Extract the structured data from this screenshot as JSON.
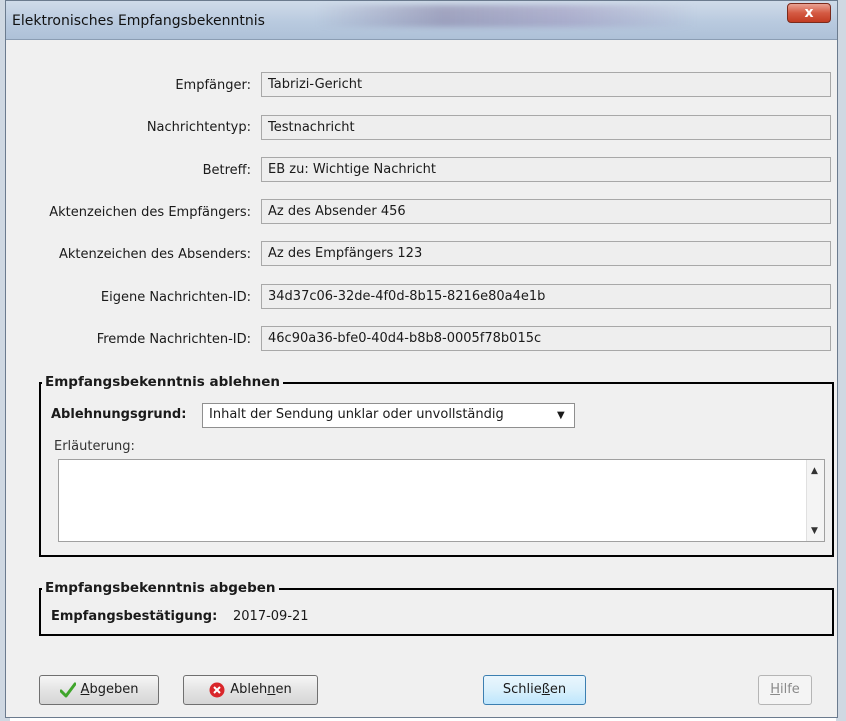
{
  "window": {
    "title": "Elektronisches Empfangsbekenntnis",
    "close_label": "x"
  },
  "fields": [
    {
      "label": "Empfänger:",
      "value": "Tabrizi-Gericht"
    },
    {
      "label": "Nachrichtentyp:",
      "value": "Testnachricht"
    },
    {
      "label": "Betreff:",
      "value": "EB zu: Wichtige Nachricht"
    },
    {
      "label": "Aktenzeichen des Empfängers:",
      "value": "Az des Absender 456"
    },
    {
      "label": "Aktenzeichen des Absenders:",
      "value": "Az des Empfängers 123"
    },
    {
      "label": "Eigene Nachrichten-ID:",
      "value": "34d37c06-32de-4f0d-8b15-8216e80a4e1b"
    },
    {
      "label": "Fremde Nachrichten-ID:",
      "value": "46c90a36-bfe0-40d4-b8b8-0005f78b015c"
    }
  ],
  "reject_group": {
    "title": "Empfangsbekenntnis ablehnen",
    "reason_label": "Ablehnungsgrund:",
    "reason_value": "Inhalt der Sendung unklar oder unvollständig",
    "explanation_label": "Erläuterung:",
    "explanation_value": ""
  },
  "accept_group": {
    "title": "Empfangsbekenntnis abgeben",
    "confirmation_label": "Empfangsbestätigung:",
    "confirmation_value": "2017-09-21"
  },
  "buttons": {
    "submit_a": "A",
    "submit_rest": "bgeben",
    "reject_pre": "Ableh",
    "reject_u": "n",
    "reject_post": "en",
    "close_pre": "Schlie",
    "close_u": "ß",
    "close_post": "en",
    "help_u": "H",
    "help_rest": "ilfe"
  },
  "colors": {
    "accent": "#3c7fb1",
    "check_green": "#3fa52b",
    "reject_red": "#d9262a"
  }
}
